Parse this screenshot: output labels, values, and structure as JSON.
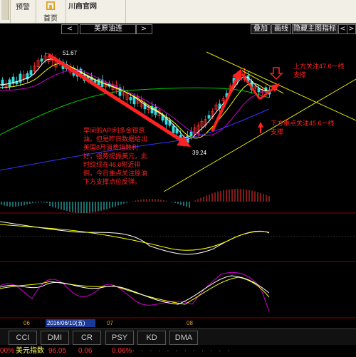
{
  "toolbar": {
    "buttons": [
      {
        "label": "",
        "name": "back-button"
      },
      {
        "label": "预警",
        "name": "alert-button"
      },
      {
        "label": "首页",
        "name": "home-button"
      }
    ],
    "site_title": "川商官网"
  },
  "nav": {
    "prev": "<",
    "next": ">",
    "title": "美原油连",
    "right_buttons": [
      "叠加",
      "画线",
      "隐藏主图指标"
    ],
    "scroll_left": "<",
    "scroll_right": ">"
  },
  "chart": {
    "high_label": "51.67",
    "low_label": "39.24",
    "annotation_main": [
      "早间的API利多金银原",
      "油。但是昨日数据给出",
      "美国8月消费指数利",
      "好，强势提振美元，此",
      "时纹线在46.0附近徘",
      "徊，今日重点关注原油",
      "下方支撑点位反弹。"
    ],
    "annotation_upper": [
      "上方关注47.6一线",
      "支撑"
    ],
    "annotation_lower": [
      "下方重点关注45.6一线",
      "支撑"
    ],
    "date_labels": [
      "06",
      "2016/06/10(五)",
      "07",
      "08"
    ],
    "colors": {
      "up": "#ff3333",
      "down": "#33dddd",
      "ma1": "#ffffff",
      "ma2": "#ffff00",
      "ma3": "#cc00cc",
      "ma4": "#00cc00",
      "ma5": "#3333ff",
      "annotation": "#ff2222",
      "arrow": "#ff2222"
    }
  },
  "tabs": [
    "CCI",
    "DMI",
    "CR",
    "PSY",
    "KD",
    "DMA"
  ],
  "status": {
    "left_fragment": "00%",
    "index_label": "美元指数",
    "index_value": "96.05",
    "change": "0.06",
    "change_pct": "0.06%"
  }
}
